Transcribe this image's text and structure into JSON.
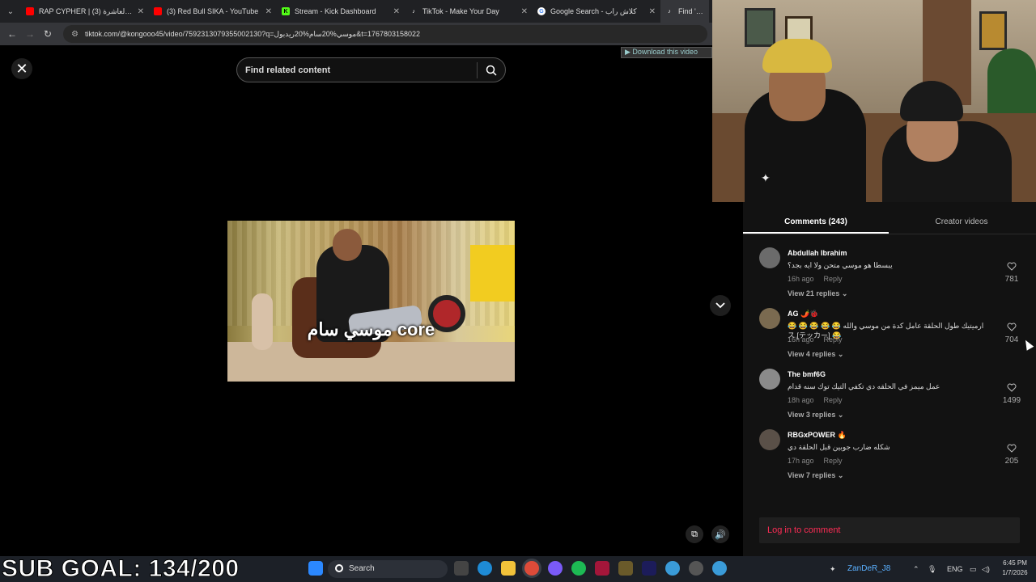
{
  "browser": {
    "tabs": [
      {
        "label": "RAP CYPHER | الحلقة العاشرة (3)",
        "icon": "youtube-icon",
        "color": "#ff0000"
      },
      {
        "label": "(3) Red Bull SIKA - YouTube",
        "icon": "youtube-icon",
        "color": "#ff0000"
      },
      {
        "label": "Stream - Kick Dashboard",
        "icon": "kick-icon",
        "color": "#53fc18"
      },
      {
        "label": "TikTok - Make Your Day",
        "icon": "tiktok-icon",
        "color": "#ffffff"
      },
      {
        "label": "Google Search - كلاش راب",
        "icon": "google-icon",
        "color": "#4285f4"
      },
      {
        "label": "Find 'ريدبول",
        "icon": "tiktok-icon",
        "color": "#ffffff"
      }
    ],
    "url": "tiktok.com/@kongooo45/video/7592313079355002130?q=موسي%20سام%20ريدبول&t=1767803158022"
  },
  "tiktok": {
    "search_placeholder": "Find related content",
    "video_caption": "موسي سام core",
    "download_bar": "▶ Download this video",
    "panel": {
      "tab_comments": "Comments (243)",
      "tab_creator": "Creator videos",
      "comments": [
        {
          "user": "Abdullah Ibrahim",
          "text": "يبسطا هو موسي متحن ولا ايه بجد؟",
          "time": "16h ago",
          "reply": "Reply",
          "replies": "View 21 replies",
          "likes": "781",
          "avatar_color": "#6b6b6b"
        },
        {
          "user": "AG 🌶️🐞",
          "text": "ارميتيك طول الحلقة عامل كدة من موسي والله 😂 😂 😂 😂 😂 😂 [ス [テッカー",
          "time": "16h ago",
          "reply": "Reply",
          "replies": "View 4 replies",
          "likes": "704",
          "avatar_color": "#7a6a50"
        },
        {
          "user": "The bmf6G",
          "text": "عمل ميمز في الحلقه دي تكفي التيك توك سنه قدام",
          "time": "18h ago",
          "reply": "Reply",
          "replies": "View 3 replies",
          "likes": "1499",
          "avatar_color": "#8a8a8a"
        },
        {
          "user": "RBGxPOWER 🔥",
          "text": "شكله ضارب جوبين قبل الحلقة دي",
          "time": "17h ago",
          "reply": "Reply",
          "replies": "View 7 replies",
          "likes": "205",
          "avatar_color": "#5a5048"
        }
      ],
      "login": "Log in to comment"
    }
  },
  "overlay": {
    "sub_goal": "SUB GOAL: 134/200"
  },
  "taskbar": {
    "search_label": "Search",
    "user": "ZanDeR_J8",
    "lang": "ENG",
    "time": "6:45 PM",
    "date": "1/7/2026"
  }
}
